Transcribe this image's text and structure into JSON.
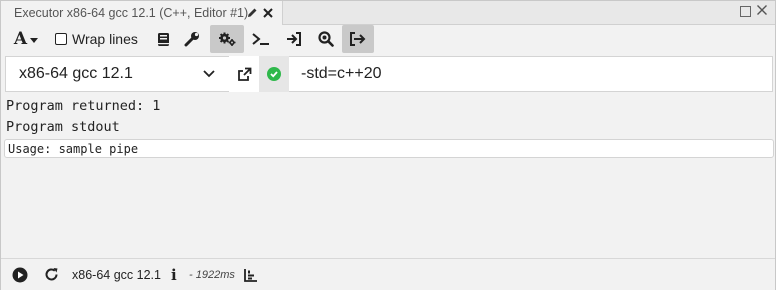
{
  "tab": {
    "title": "Executor x86-64 gcc 12.1 (C++, Editor #1)",
    "icons": [
      "pencil-icon",
      "close-icon"
    ]
  },
  "window": {
    "icons": [
      "maximize-icon",
      "close-icon"
    ],
    "close_glyph": "☐"
  },
  "toolbar": {
    "font_glyph": "A",
    "wrap_label": "Wrap lines",
    "wrap_checked": false,
    "icons": [
      "font-size-icon",
      "book-icon",
      "wrench-icon",
      "gears-icon",
      "terminal-icon",
      "sign-in-icon",
      "search-icon",
      "sign-out-icon"
    ]
  },
  "compiler": {
    "name": "x86-64 gcc 12.1",
    "options": "-std=c++20",
    "status_color": "#2fb84b"
  },
  "output": {
    "returned": "Program returned: 1",
    "stdout_header": "Program stdout",
    "stdout_text": "Usage: sample pipe"
  },
  "statusbar": {
    "compiler_name": "x86-64 gcc 12.1",
    "info_glyph": "i",
    "time": "- 1922ms",
    "icons": [
      "play-icon",
      "refresh-icon",
      "info-icon",
      "bar-chart-icon"
    ]
  }
}
